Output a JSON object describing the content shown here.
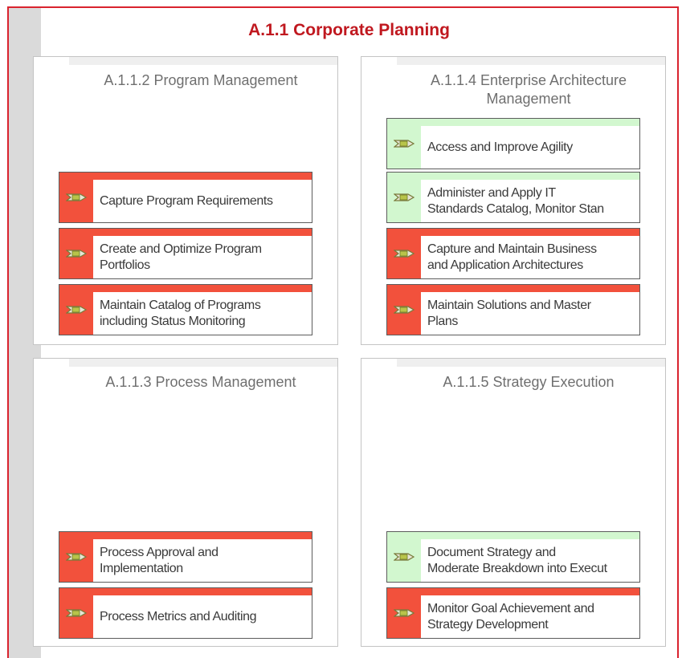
{
  "diagram": {
    "title": "A.1.1 Corporate Planning",
    "colors": {
      "accent": "#c0181f",
      "red_status": "#f2513c",
      "green_status": "#d2f7cf"
    },
    "panels": [
      {
        "title": "A.1.1.2 Program Management",
        "cards": [
          {
            "label": "Capture Program Requirements",
            "status": "red",
            "icon": "process-icon"
          },
          {
            "label": "Create and Optimize Program\nPortfolios",
            "status": "red",
            "icon": "process-icon"
          },
          {
            "label": "Maintain Catalog of Programs\nincluding Status Monitoring",
            "status": "red",
            "icon": "process-icon"
          }
        ]
      },
      {
        "title": "A.1.1.4 Enterprise Architecture\nManagement",
        "cards": [
          {
            "label": "Access and Improve Agility",
            "status": "green",
            "icon": "process-icon"
          },
          {
            "label": "Administer and Apply IT\nStandards Catalog, Monitor Stan",
            "status": "green",
            "icon": "process-icon"
          },
          {
            "label": "Capture and Maintain Business\nand Application Architectures",
            "status": "red",
            "icon": "process-icon"
          },
          {
            "label": "Maintain Solutions and Master\nPlans",
            "status": "red",
            "icon": "process-icon"
          }
        ]
      },
      {
        "title": "A.1.1.3 Process Management",
        "cards": [
          {
            "label": "Process Approval and\nImplementation",
            "status": "red",
            "icon": "process-icon"
          },
          {
            "label": "Process Metrics and Auditing",
            "status": "red",
            "icon": "process-icon"
          }
        ]
      },
      {
        "title": "A.1.1.5 Strategy Execution",
        "cards": [
          {
            "label": "Document Strategy and\nModerate Breakdown into Execut",
            "status": "green",
            "icon": "process-icon"
          },
          {
            "label": "Monitor Goal Achievement and\nStrategy Development",
            "status": "red",
            "icon": "process-icon"
          }
        ]
      }
    ]
  }
}
